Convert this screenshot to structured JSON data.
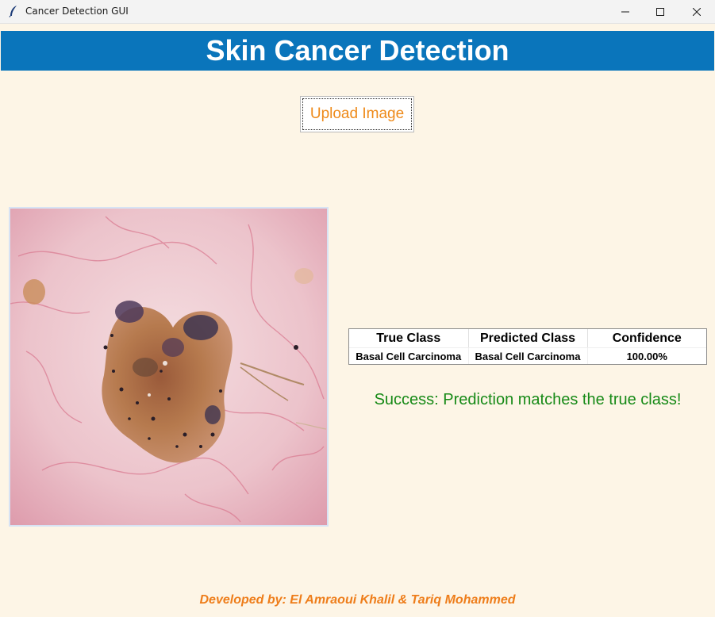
{
  "window": {
    "title": "Cancer Detection GUI",
    "app_icon": "feather-icon",
    "controls": [
      "minimize-icon",
      "maximize-icon",
      "close-icon"
    ]
  },
  "header": {
    "title": "Skin Cancer Detection",
    "background_color": "#0a75bb"
  },
  "upload": {
    "label": "Upload Image",
    "label_color": "#ee8a1a"
  },
  "image": {
    "description_hidden": true
  },
  "results": {
    "columns": [
      "True Class",
      "Predicted Class",
      "Confidence"
    ],
    "rows": [
      [
        "Basal Cell Carcinoma",
        "Basal Cell Carcinoma",
        "100.00%"
      ]
    ]
  },
  "status": {
    "message": "Success: Prediction matches the true class!",
    "color": "#178a17"
  },
  "footer": {
    "credit": "Developed by: El Amraoui Khalil & Tariq Mohammed",
    "color": "#ee7d1a"
  },
  "background_color": "#fdf5e6"
}
